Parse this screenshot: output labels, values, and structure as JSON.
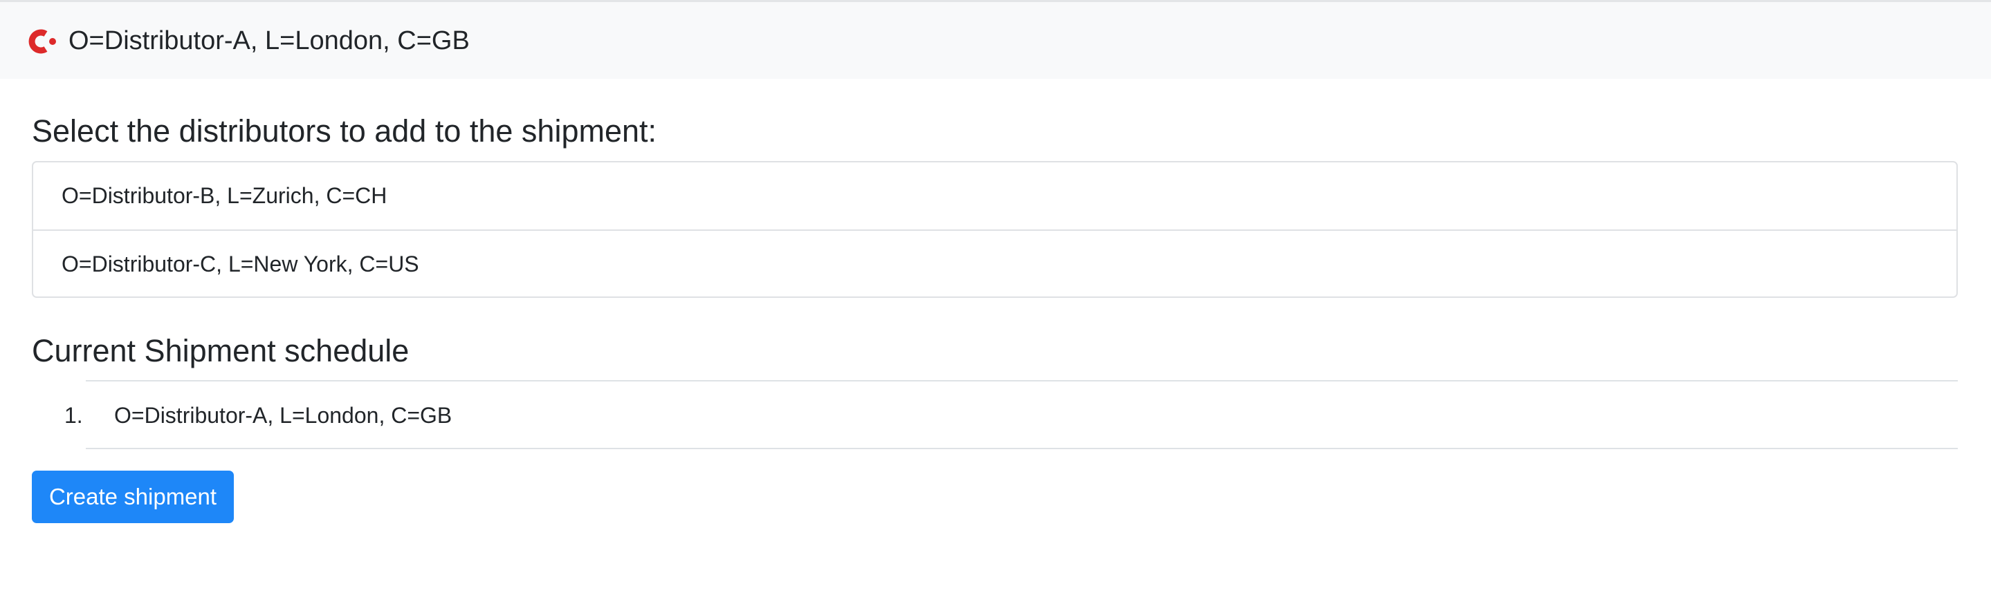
{
  "header": {
    "logo_icon": "corda-logo-icon",
    "accent_color": "#dd2a2a",
    "title": "O=Distributor-A, L=London, C=GB"
  },
  "distributors": {
    "heading": "Select the distributors to add to the shipment:",
    "items": [
      {
        "label": "O=Distributor-B, L=Zurich, C=CH"
      },
      {
        "label": "O=Distributor-C, L=New York, C=US"
      }
    ]
  },
  "schedule": {
    "heading": "Current Shipment schedule",
    "rows": [
      {
        "index": "1.",
        "value": "O=Distributor-A, L=London, C=GB"
      }
    ]
  },
  "actions": {
    "create_label": "Create shipment",
    "primary_color": "#1e87f8"
  }
}
